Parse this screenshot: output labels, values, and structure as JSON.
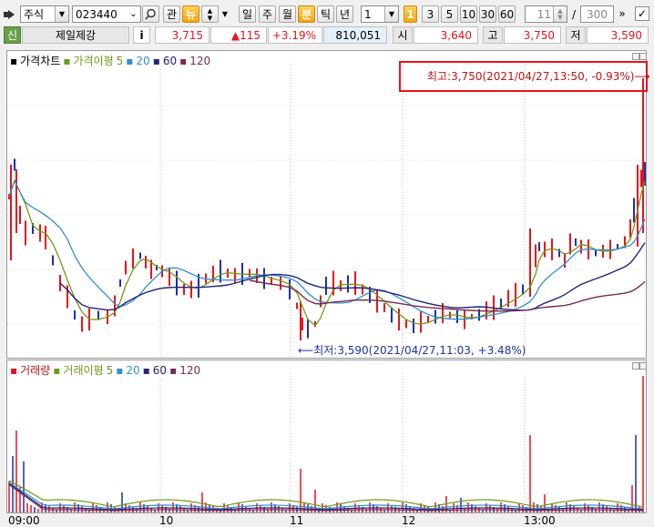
{
  "toolbar": {
    "market_select": "주식",
    "code_input": "023440",
    "btn_gwan": "관",
    "btn_new": "뉴",
    "periods": [
      "일",
      "주",
      "월",
      "분",
      "틱",
      "년"
    ],
    "interval_value": "1",
    "minute_options": [
      "3",
      "5",
      "10",
      "30",
      "60"
    ],
    "count_value": "11",
    "slash": "/",
    "total_value": "300",
    "highlight_color": "#f3a512"
  },
  "quote": {
    "badge": "신",
    "name": "제일제강",
    "info_button": "i",
    "price": "3,715",
    "change": "▲115",
    "change_pct": "+3.19%",
    "volume": "810,051",
    "open_label": "시",
    "open": "3,640",
    "high_label": "고",
    "high": "3,750",
    "low_label": "저",
    "low": "3,590",
    "up_color": "#e8131b"
  },
  "price_panel": {
    "legend_title": "가격차트",
    "ma_label": "가격이평",
    "ma_periods": [
      "5",
      "20",
      "60",
      "120"
    ],
    "max_annotation": "최고:3,750(2021/04/27,13:50, -0.93%)⟶",
    "min_annotation": "⟵최저:3,590(2021/04/27,11:03, +3.48%)"
  },
  "volume_panel": {
    "legend_title": "거래량",
    "ma_label": "거래이평",
    "ma_periods": [
      "5",
      "20",
      "60",
      "120"
    ]
  },
  "ma_colors": {
    "ma5": "#6e9a16",
    "ma20": "#2f8fd0",
    "ma60": "#23237a",
    "ma120": "#7a2a50"
  },
  "chart_data": {
    "type": "bar",
    "x_ticks": [
      "09:00",
      "10",
      "11",
      "12",
      "13:00"
    ],
    "price_high": 3750,
    "price_low": 3590,
    "grid": true
  }
}
